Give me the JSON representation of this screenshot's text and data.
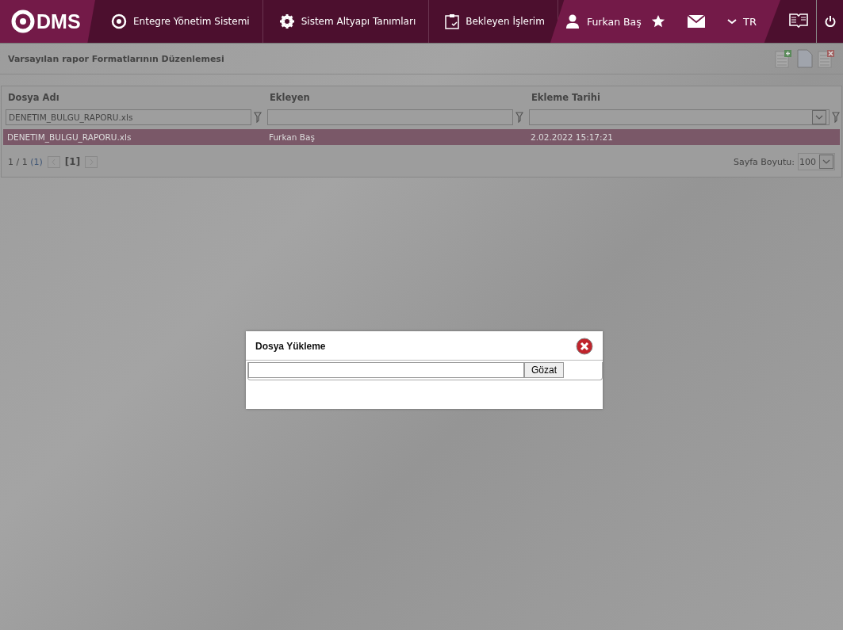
{
  "nav": {
    "logo": "DMS",
    "items": [
      {
        "kind": "q",
        "label": "Entegre Yönetim Sistemi"
      },
      {
        "kind": "gear",
        "label": "Sistem Altyapı Tanımları"
      },
      {
        "kind": "clipboard",
        "label": "Bekleyen İşlerim"
      }
    ],
    "user": "Furkan Baş",
    "language": "TR"
  },
  "page_title": "Varsayılan rapor Formatlarının Düzenlemesi",
  "table": {
    "columns": [
      {
        "label": "Dosya Adı",
        "filter": "DENETIM_BULGU_RAPORU.xls",
        "kind": "text"
      },
      {
        "label": "Ekleyen",
        "kind": "text"
      },
      {
        "label": "Ekleme Tarihi",
        "kind": "date"
      }
    ],
    "rows": [
      {
        "selected": true,
        "cells": [
          "DENETIM_BULGU_RAPORU.xls",
          "Furkan Baş",
          "2.02.2022 15:17:21"
        ]
      }
    ],
    "pager": {
      "summary": "1 / 1",
      "total": "(1)",
      "current": "[1]",
      "page_size_label": "Sayfa Boyutu:",
      "page_size": "100"
    }
  },
  "dialog": {
    "title": "Dosya Yükleme",
    "browse_button": "Gözat"
  }
}
